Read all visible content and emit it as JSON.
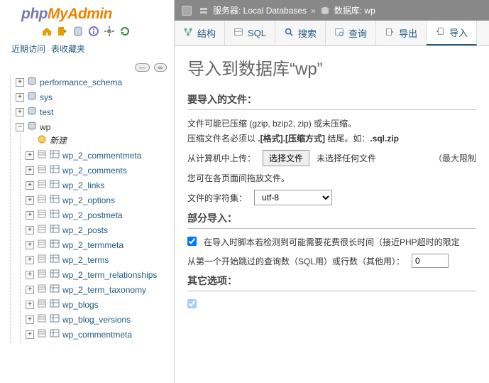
{
  "logo": {
    "part1": "php",
    "part2": "MyAdmin"
  },
  "sidebarIcons": {
    "home": "home-icon",
    "logout": "exit-icon",
    "sql": "sql-icon",
    "docs": "docs-icon",
    "settings": "gear-icon",
    "reload": "reload-icon"
  },
  "sideTabs": {
    "recent": "近期访问",
    "favorites": "表收藏夹"
  },
  "collapse": {
    "btn1": "—",
    "btn2": "∞"
  },
  "tree": {
    "dbs": [
      {
        "name": "performance_schema",
        "expanded": false
      },
      {
        "name": "sys",
        "expanded": false
      },
      {
        "name": "test",
        "expanded": false
      },
      {
        "name": "wp",
        "expanded": true,
        "selected": true,
        "new": "新建",
        "tables": [
          "wp_2_commentmeta",
          "wp_2_comments",
          "wp_2_links",
          "wp_2_options",
          "wp_2_postmeta",
          "wp_2_posts",
          "wp_2_termmeta",
          "wp_2_terms",
          "wp_2_term_relationships",
          "wp_2_term_taxonomy",
          "wp_blogs",
          "wp_blog_versions",
          "wp_commentmeta"
        ]
      }
    ]
  },
  "breadcrumb": {
    "serverLabel": "服务器: Local Databases",
    "dbLabel": "数据库: wp",
    "sep": "»"
  },
  "tabs": [
    {
      "key": "structure",
      "label": "结构"
    },
    {
      "key": "sql",
      "label": "SQL"
    },
    {
      "key": "search",
      "label": "搜索"
    },
    {
      "key": "query",
      "label": "查询"
    },
    {
      "key": "export",
      "label": "导出"
    },
    {
      "key": "import",
      "label": "导入",
      "active": true
    }
  ],
  "content": {
    "heading": "导入到数据库“wp”",
    "fileSection": {
      "title": "要导入的文件：",
      "line1": "文件可能已压缩 (gzip, bzip2, zip) 或未压缩。",
      "line2_pre": "压缩文件名必须以 ",
      "line2_b1": ".[格式].[压缩方式]",
      "line2_mid": " 结尾。如：",
      "line2_b2": ".sql.zip",
      "uploadLabel": "从计算机中上传：",
      "chooseBtn": "选择文件",
      "noFile": "未选择任何文件",
      "maxNote": "（最大限制",
      "dragHint": "您可在各页面间拖放文件。",
      "charsetLabel": "文件的字符集：",
      "charsetValue": "utf-8"
    },
    "partialSection": {
      "title": "部分导入：",
      "chkLabel": "在导入时脚本若检测到可能需要花费很长时间（接近PHP超时的限定",
      "skipLabel": "从第一个开始跳过的查询数（SQL用）或行数（其他用）：",
      "skipValue": "0"
    },
    "otherSection": {
      "title": "其它选项："
    }
  }
}
